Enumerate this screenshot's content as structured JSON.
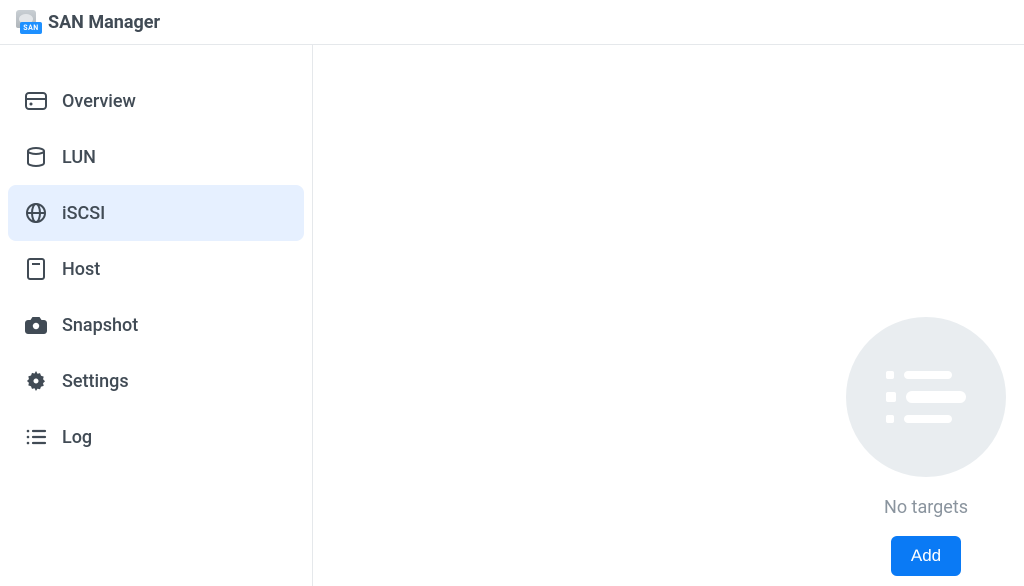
{
  "header": {
    "app_title": "SAN Manager",
    "icon_badge": "SAN"
  },
  "sidebar": {
    "items": [
      {
        "id": "overview",
        "label": "Overview",
        "active": false
      },
      {
        "id": "lun",
        "label": "LUN",
        "active": false
      },
      {
        "id": "iscsi",
        "label": "iSCSI",
        "active": true
      },
      {
        "id": "host",
        "label": "Host",
        "active": false
      },
      {
        "id": "snapshot",
        "label": "Snapshot",
        "active": false
      },
      {
        "id": "settings",
        "label": "Settings",
        "active": false
      },
      {
        "id": "log",
        "label": "Log",
        "active": false
      }
    ]
  },
  "main": {
    "empty_state_text": "No targets",
    "add_button_label": "Add"
  }
}
